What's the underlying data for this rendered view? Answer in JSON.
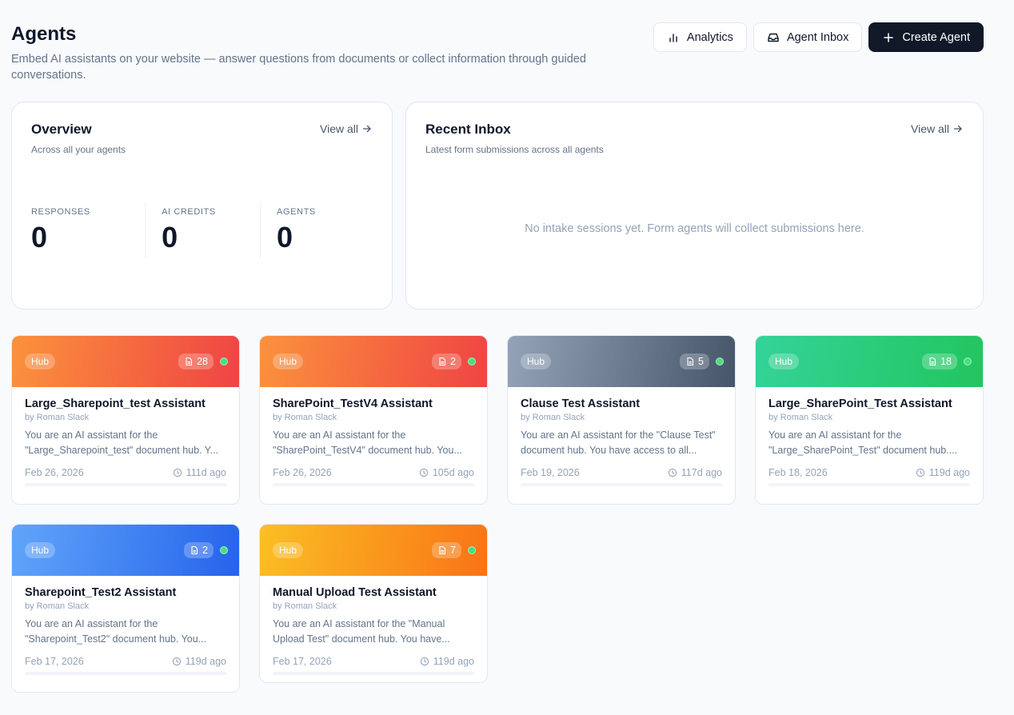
{
  "header": {
    "title": "Agents",
    "subtitle": "Embed AI assistants on your website — answer questions from documents or collect information through guided conversations.",
    "analytics_label": "Analytics",
    "inbox_label": "Agent Inbox",
    "create_label": "Create Agent"
  },
  "overview": {
    "title": "Overview",
    "subtitle": "Across all your agents",
    "view_all": "View all",
    "stats": [
      {
        "label": "RESPONSES",
        "value": "0"
      },
      {
        "label": "AI CREDITS",
        "value": "0"
      },
      {
        "label": "AGENTS",
        "value": "0"
      }
    ]
  },
  "inbox": {
    "title": "Recent Inbox",
    "subtitle": "Latest form submissions across all agents",
    "view_all": "View all",
    "empty": "No intake sessions yet. Form agents will collect submissions here."
  },
  "agents": [
    {
      "badge": "Hub",
      "docs": "28",
      "title": "Large_Sharepoint_test Assistant",
      "author": "by Roman Slack",
      "desc": "You are an AI assistant for the \"Large_Sharepoint_test\" document hub. Y...",
      "date": "Feb 26, 2026",
      "age": "111d ago",
      "gradient": [
        "#fb923c",
        "#ef4444"
      ]
    },
    {
      "badge": "Hub",
      "docs": "2",
      "title": "SharePoint_TestV4 Assistant",
      "author": "by Roman Slack",
      "desc": "You are an AI assistant for the \"SharePoint_TestV4\" document hub. You...",
      "date": "Feb 26, 2026",
      "age": "105d ago",
      "gradient": [
        "#fb923c",
        "#ef4444"
      ]
    },
    {
      "badge": "Hub",
      "docs": "5",
      "title": "Clause Test Assistant",
      "author": "by Roman Slack",
      "desc": "You are an AI assistant for the \"Clause Test\" document hub. You have access to all...",
      "date": "Feb 19, 2026",
      "age": "117d ago",
      "gradient": [
        "#94a3b8",
        "#475569"
      ]
    },
    {
      "badge": "Hub",
      "docs": "18",
      "title": "Large_SharePoint_Test Assistant",
      "author": "by Roman Slack",
      "desc": "You are an AI assistant for the \"Large_SharePoint_Test\" document hub....",
      "date": "Feb 18, 2026",
      "age": "119d ago",
      "gradient": [
        "#34d399",
        "#22c55e"
      ]
    },
    {
      "badge": "Hub",
      "docs": "2",
      "title": "Sharepoint_Test2 Assistant",
      "author": "by Roman Slack",
      "desc": "You are an AI assistant for the \"Sharepoint_Test2\" document hub. You...",
      "date": "Feb 17, 2026",
      "age": "119d ago",
      "gradient": [
        "#60a5fa",
        "#2563eb"
      ]
    },
    {
      "badge": "Hub",
      "docs": "7",
      "title": "Manual Upload Test Assistant",
      "author": "by Roman Slack",
      "desc": "You are an AI assistant for the \"Manual Upload Test\" document hub. You have...",
      "date": "Feb 17, 2026",
      "age": "119d ago",
      "gradient": [
        "#fbbf24",
        "#f97316"
      ]
    }
  ]
}
